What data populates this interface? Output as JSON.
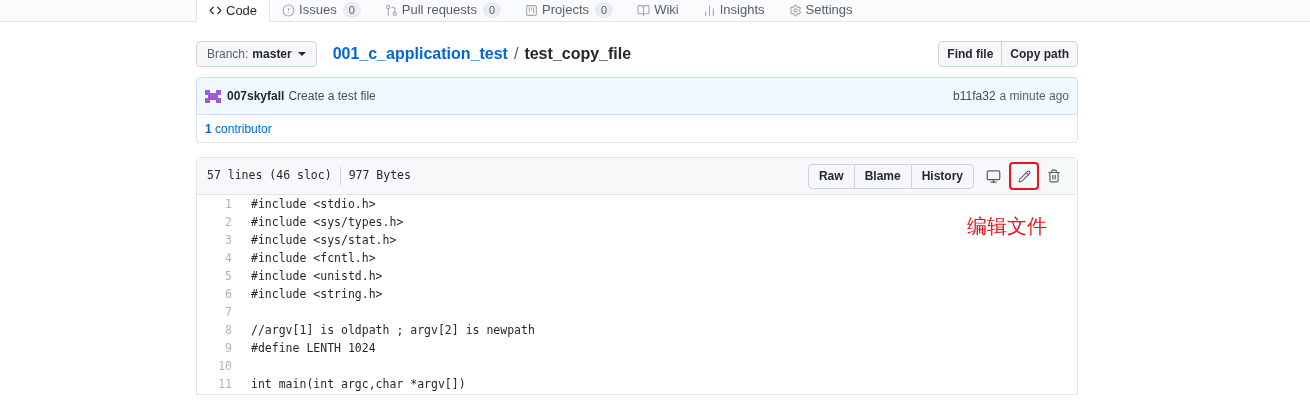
{
  "tabs": [
    {
      "label": "Code",
      "selected": true
    },
    {
      "label": "Issues",
      "count": "0",
      "selected": false
    },
    {
      "label": "Pull requests",
      "count": "0",
      "selected": false
    },
    {
      "label": "Projects",
      "count": "0",
      "selected": false
    },
    {
      "label": "Wiki",
      "selected": false
    },
    {
      "label": "Insights",
      "selected": false
    },
    {
      "label": "Settings",
      "selected": false
    }
  ],
  "branch": {
    "label": "Branch:",
    "value": "master"
  },
  "breadcrumb": {
    "repo": "001_c_application_test",
    "separator": "/",
    "file": "test_copy_file"
  },
  "file_buttons": [
    "Find file",
    "Copy path"
  ],
  "commit": {
    "author": "007skyfall",
    "message": "Create a test file",
    "sha": "b11fa32",
    "time": "a minute ago"
  },
  "contributors": {
    "count": "1",
    "label": "contributor"
  },
  "file_info": {
    "lines": "57 lines (46 sloc)",
    "size": "977 Bytes"
  },
  "view_buttons": [
    "Raw",
    "Blame",
    "History"
  ],
  "annotation": {
    "text": "编辑文件"
  },
  "code_lines": [
    {
      "number": "1",
      "text": "#include <stdio.h>"
    },
    {
      "number": "2",
      "text": "#include <sys/types.h>"
    },
    {
      "number": "3",
      "text": "#include <sys/stat.h>"
    },
    {
      "number": "4",
      "text": "#include <fcntl.h>"
    },
    {
      "number": "5",
      "text": "#include <unistd.h>"
    },
    {
      "number": "6",
      "text": "#include <string.h>"
    },
    {
      "number": "7"
    },
    {
      "number": "8",
      "text": "//argv[1] is oldpath ; argv[2] is newpath"
    },
    {
      "number": "9",
      "text": "#define LENTH 1024"
    },
    {
      "number": "10"
    },
    {
      "number": "11",
      "text": "int main(int argc,char *argv[])"
    }
  ]
}
